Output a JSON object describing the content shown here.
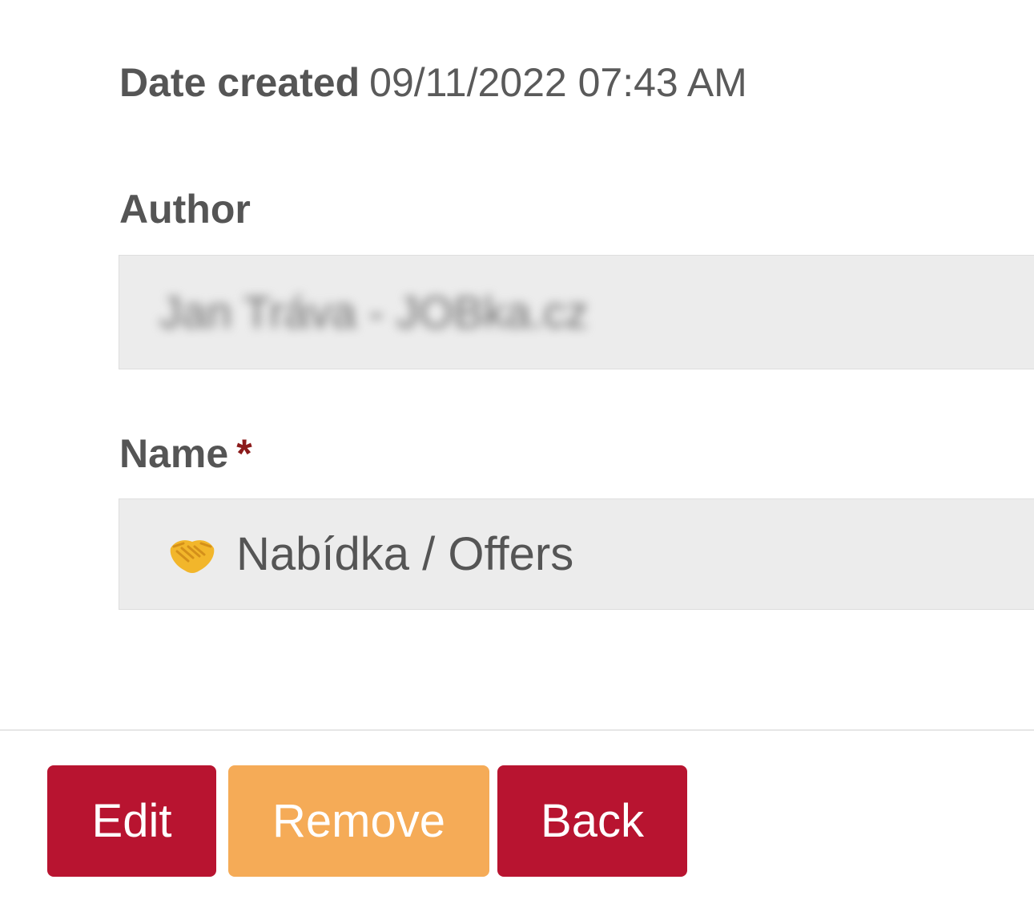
{
  "date_created": {
    "label": "Date created",
    "value": "09/11/2022 07:43 AM"
  },
  "author": {
    "label": "Author",
    "value": "Jan Tráva - JOBka.cz"
  },
  "name": {
    "label": "Name",
    "required_mark": "*",
    "icon": "handshake-icon",
    "value": "Nabídka / Offers"
  },
  "actions": {
    "edit_label": "Edit",
    "remove_label": "Remove",
    "back_label": "Back"
  },
  "colors": {
    "primary": "#b81430",
    "warning": "#f5ab57",
    "field_background": "#ececec",
    "required": "#8b1a1a"
  }
}
